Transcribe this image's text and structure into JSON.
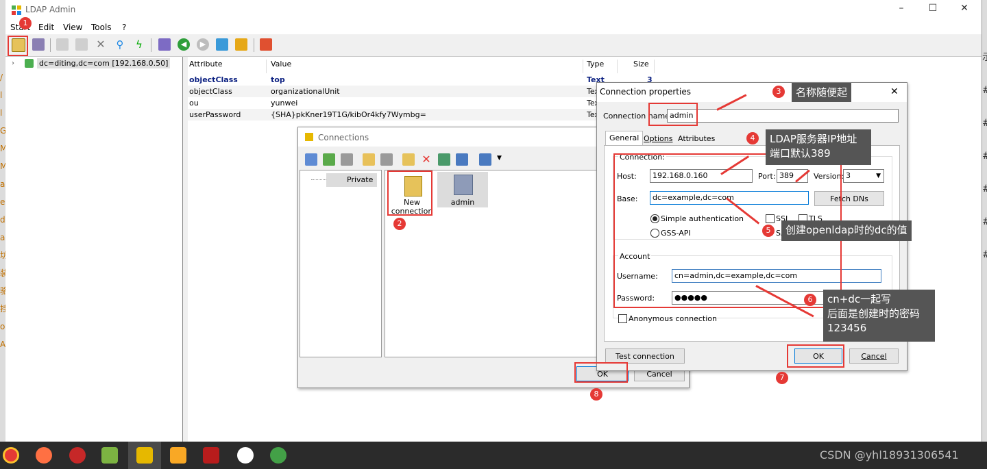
{
  "app": {
    "title": "LDAP Admin",
    "menu": [
      "Start",
      "Edit",
      "View",
      "Tools",
      "?"
    ],
    "window_controls": [
      "–",
      "☐",
      "✕"
    ]
  },
  "tree": {
    "root_label": "dc=diting,dc=com [192.168.0.50]"
  },
  "attributes": {
    "headers": [
      "Attribute",
      "Value",
      "Type",
      "Size"
    ],
    "rows": [
      {
        "attr": "objectClass",
        "value": "top",
        "type": "Text",
        "size": "3"
      },
      {
        "attr": "objectClass",
        "value": "organizationalUnit",
        "type": "Tex",
        "size": ""
      },
      {
        "attr": "ou",
        "value": "yunwei",
        "type": "Tex",
        "size": ""
      },
      {
        "attr": "userPassword",
        "value": "{SHA}pkKner19T1G/kibOr4kfy7Wymbg=",
        "type": "Tex",
        "size": ""
      }
    ]
  },
  "connections_dialog": {
    "title": "Connections",
    "tree_item": "Private",
    "items": [
      {
        "label_line1": "New",
        "label_line2": "connection"
      },
      {
        "label_line1": "admin",
        "label_line2": ""
      }
    ],
    "ok": "OK",
    "cancel": "Cancel"
  },
  "conn_props": {
    "title": "Connection properties",
    "close": "✕",
    "name_label": "Connection name:",
    "name_value": "admin",
    "tabs": [
      "General",
      "Options",
      "Attributes"
    ],
    "connection_group": "Connection:",
    "host_label": "Host:",
    "host_value": "192.168.0.160",
    "port_label": "Port:",
    "port_value": "389",
    "version_label": "Version:",
    "version_value": "3",
    "base_label": "Base:",
    "base_value": "dc=example,dc=com",
    "fetch_dns": "Fetch DNs",
    "simple_auth": "Simple authentication",
    "gss_api": "GSS-API",
    "ssl": "SSL",
    "tls": "TLS",
    "sasl_partial": "SA",
    "account_group": "Account",
    "username_label": "Username:",
    "username_value": "cn=admin,dc=example,dc=com",
    "password_label": "Password:",
    "password_value": "●●●●●",
    "anonymous": "Anonymous connection",
    "test_connection": "Test connection",
    "ok": "OK",
    "cancel": "Cancel"
  },
  "annotations": {
    "badges": [
      "1",
      "2",
      "3",
      "4",
      "5",
      "6",
      "7",
      "8"
    ],
    "callout3": "名称随便起",
    "callout4_line1": "LDAP服务器IP地址",
    "callout4_line2": "端口默认389",
    "callout5": "创建openldap时的dc的值",
    "callout6_line1": "cn+dc一起写",
    "callout6_line2": "后面是创建时的密码",
    "callout6_line3": "123456",
    "color": "#e53935"
  },
  "left_edge_chars": [
    "/",
    "l",
    "l",
    "G",
    "M",
    "M",
    "a",
    "e",
    "d",
    "a",
    "坊",
    "装",
    "骆",
    "挂",
    "o",
    "A"
  ],
  "right_edge_chars": [
    "示",
    "#",
    "#",
    "#",
    "#",
    "#",
    "#"
  ],
  "watermark": "CSDN @yhl18931306541"
}
